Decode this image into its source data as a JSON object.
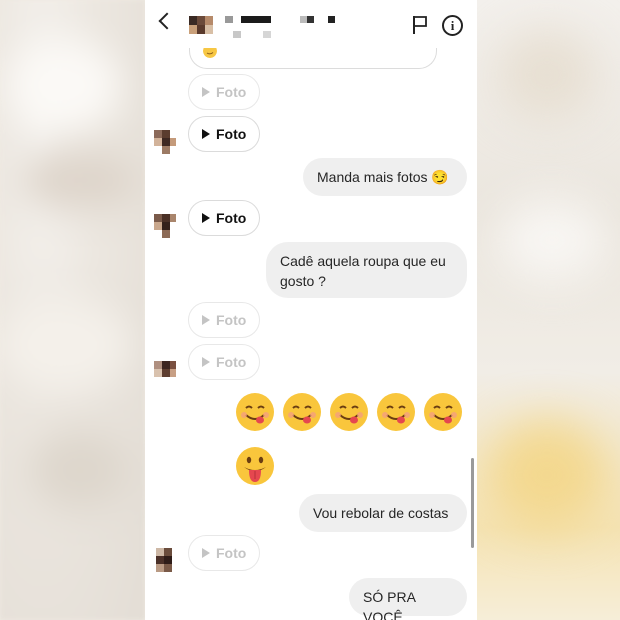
{
  "header": {
    "back_icon": "chevron-left-icon",
    "flag_icon": "flag-icon",
    "info_icon": "info-icon",
    "info_glyph": "i"
  },
  "messages": {
    "foto_label": "Foto",
    "out_1": "Manda mais fotos 😏",
    "out_2": "Cadê aquela roupa que eu gosto ?",
    "out_3": "Vou rebolar de costas",
    "out_4": "SÓ PRA VOCÊ"
  },
  "emoji_row": {
    "icons": [
      "yum-emoji",
      "yum-emoji",
      "yum-emoji",
      "yum-emoji",
      "yum-emoji",
      "tongue-out-emoji"
    ]
  },
  "colors": {
    "outgoing_bubble": "#efefef",
    "accent_text": "#262626",
    "faded_text": "#c4c4c4"
  }
}
